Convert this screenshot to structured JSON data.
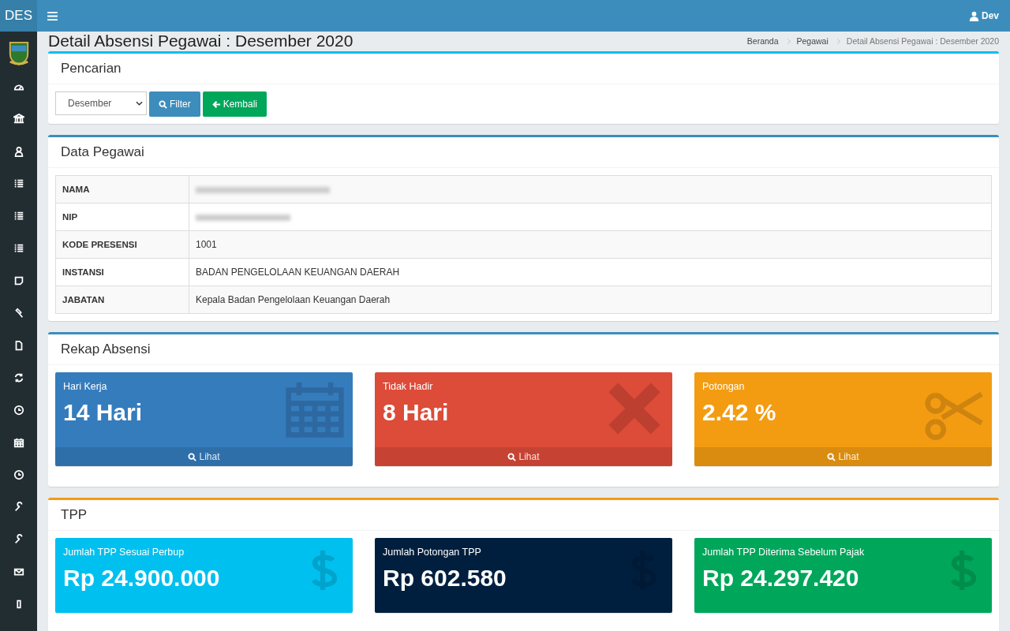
{
  "topbar": {
    "logo": "DES",
    "user": "Dev"
  },
  "page": {
    "title": "Detail Absensi Pegawai : Desember 2020",
    "breadcrumbs": [
      "Beranda",
      "Pegawai",
      "Detail Absensi Pegawai : Desember 2020"
    ]
  },
  "search_box": {
    "title": "Pencarian",
    "month_select": "Desember",
    "filter_button": "Filter",
    "back_button": "Kembali"
  },
  "employee_box": {
    "title": "Data Pegawai",
    "rows": [
      {
        "label": "NAMA",
        "value": null
      },
      {
        "label": "NIP",
        "value": null
      },
      {
        "label": "KODE PRESENSI",
        "value": "1001"
      },
      {
        "label": "INSTANSI",
        "value": "BADAN PENGELOLAAN KEUANGAN DAERAH"
      },
      {
        "label": "JABATAN",
        "value": "Kepala Badan Pengelolaan Keuangan Daerah"
      }
    ]
  },
  "recap_box": {
    "title": "Rekap Absensi",
    "stats": [
      {
        "label": "Hari Kerja",
        "value": "14 Hari",
        "link": "Lihat",
        "color": "#357cbd"
      },
      {
        "label": "Tidak Hadir",
        "value": "8 Hari",
        "link": "Lihat",
        "color": "#dd4b39"
      },
      {
        "label": "Potongan",
        "value": "2.42 %",
        "link": "Lihat",
        "color": "#f39c12"
      }
    ]
  },
  "tpp_box": {
    "title": "TPP",
    "stats": [
      {
        "label": "Jumlah TPP Sesuai Perbup",
        "value": "Rp 24.900.000",
        "color": "#00c0ef"
      },
      {
        "label": "Jumlah Potongan TPP",
        "value": "Rp 602.580",
        "color": "#001f3f"
      },
      {
        "label": "Jumlah TPP Diterima Sebelum Pajak",
        "value": "Rp 24.297.420",
        "color": "#00a65a"
      }
    ]
  }
}
